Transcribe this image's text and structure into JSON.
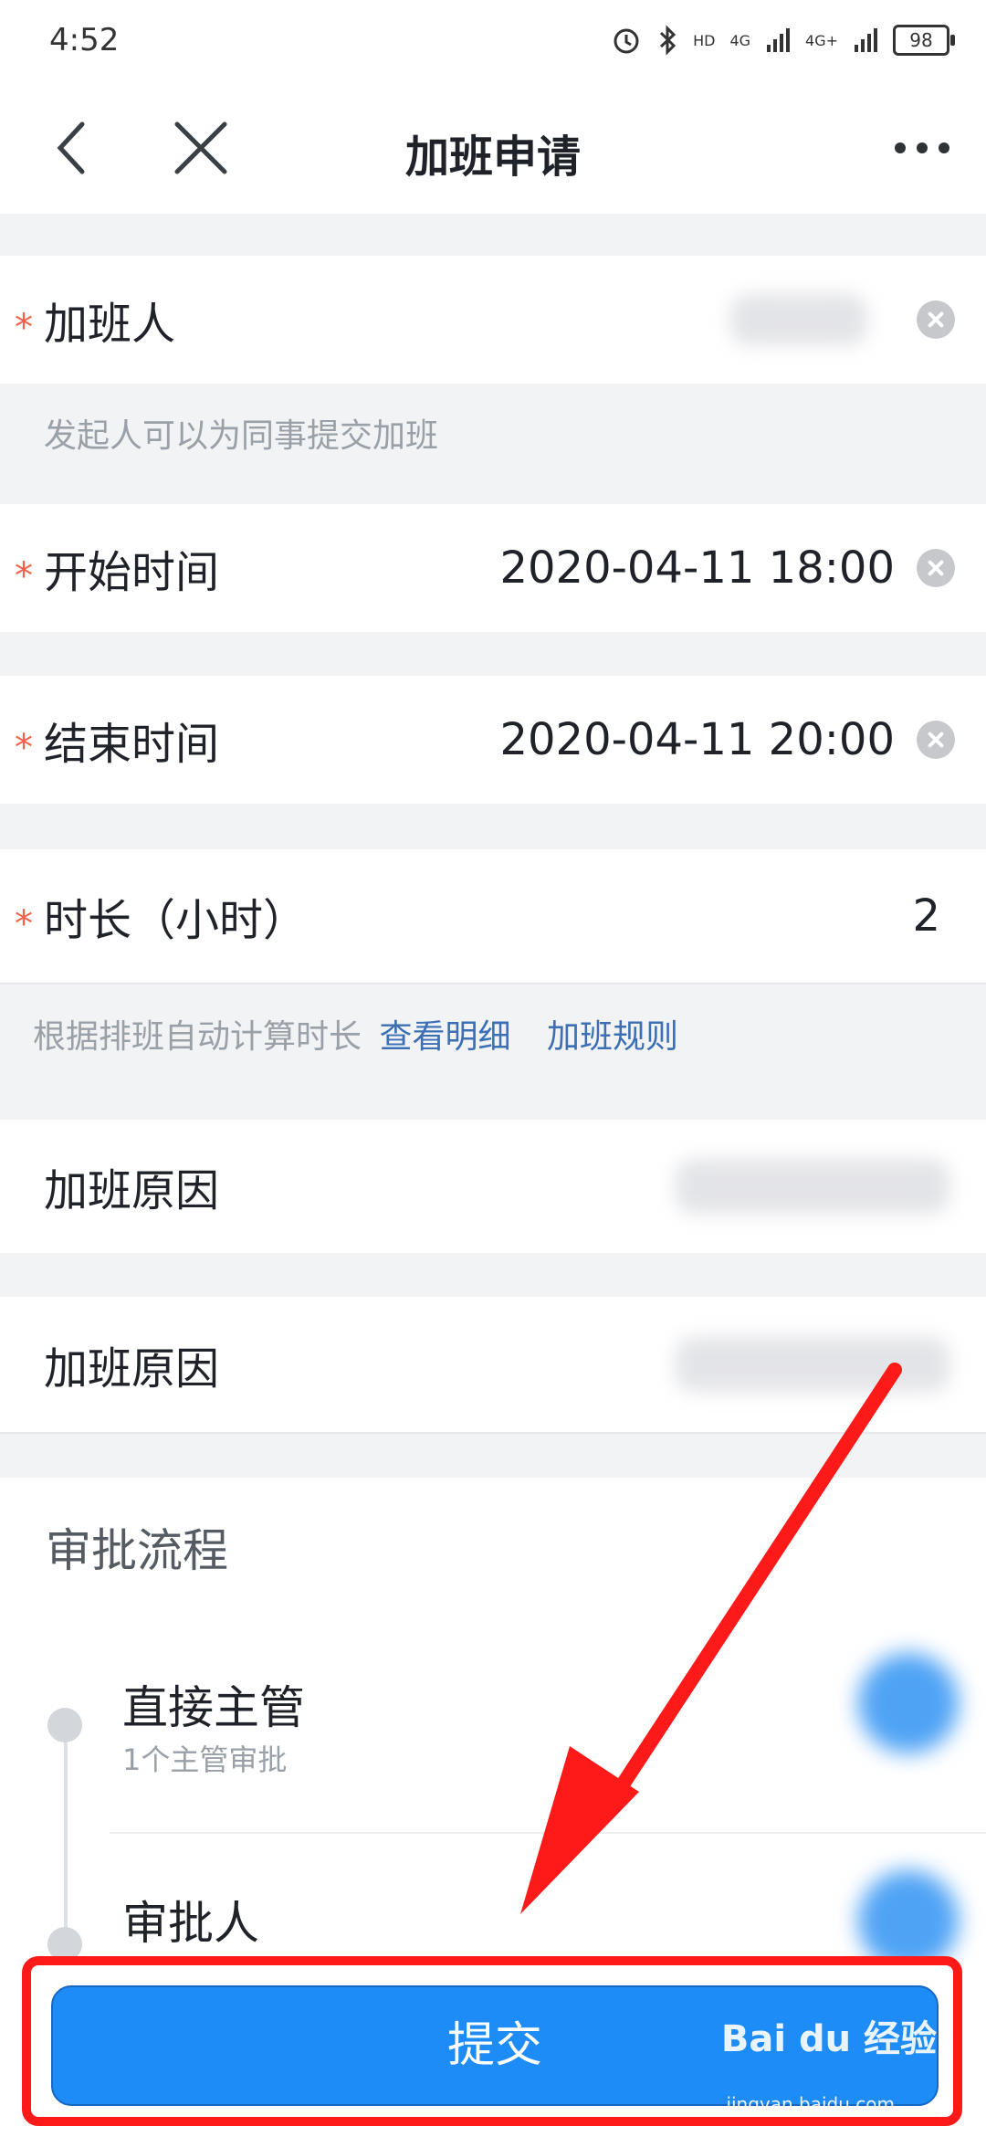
{
  "status_bar": {
    "time": "4:52",
    "hd": "HD",
    "net1": "4G",
    "net2": "4G+",
    "battery": "98"
  },
  "nav": {
    "title": "加班申请"
  },
  "form": {
    "person_label": "加班人",
    "person_hint": "发起人可以为同事提交加班",
    "start_label": "开始时间",
    "start_value": "2020-04-11 18:00",
    "end_label": "结束时间",
    "end_value": "2020-04-11 20:00",
    "duration_label": "时长（小时）",
    "duration_value": "2",
    "duration_hint": "根据排班自动计算时长",
    "view_detail": "查看明细",
    "overtime_rules": "加班规则",
    "reason_label_1": "加班原因",
    "reason_label_2": "加班原因"
  },
  "approval": {
    "title": "审批流程",
    "steps": [
      {
        "title": "直接主管",
        "sub": "1个主管审批"
      },
      {
        "title": "审批人",
        "sub": ""
      }
    ]
  },
  "submit_label": "提交",
  "watermark": {
    "brand": "Bai du 经验",
    "url": "jingyan.baidu.com"
  },
  "colors": {
    "accent": "#1e8cf7",
    "required": "#f5604a",
    "link": "#3c6fb3",
    "annotation": "#ff1a1a"
  }
}
